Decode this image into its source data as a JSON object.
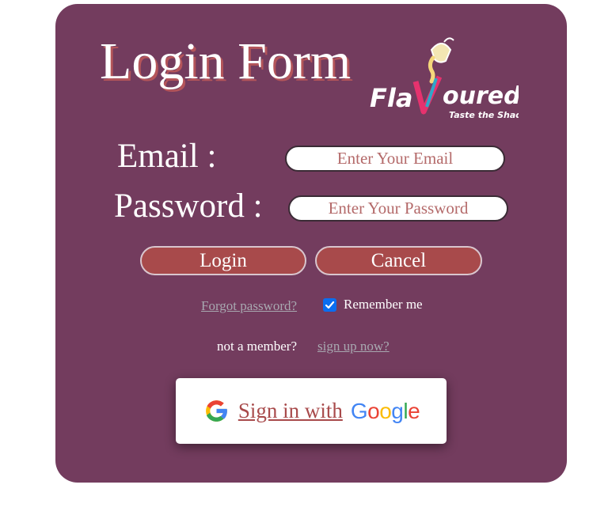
{
  "form": {
    "title": "Login Form",
    "logo": {
      "brand": "FlaVoured",
      "tagline": "Taste the Shades",
      "icon": "paint-cup-icon"
    },
    "email": {
      "label": "Email :",
      "placeholder": "Enter Your Email",
      "value": ""
    },
    "password": {
      "label": "Password :",
      "placeholder": "Enter Your Password",
      "value": ""
    },
    "buttons": {
      "login_label": "Login",
      "cancel_label": "Cancel"
    },
    "forgot_password_label": "Forgot password?",
    "remember_me": {
      "label": "Remember me",
      "checked": true
    },
    "signup_prompt": "not a member?",
    "signup_link_label": "sign up now?",
    "google": {
      "label": "Sign in with",
      "word": [
        "G",
        "o",
        "o",
        "g",
        "l",
        "e"
      ],
      "icon": "google-g-icon"
    }
  },
  "colors": {
    "card_bg": "#733c5e",
    "button_bg": "#a84a4b",
    "link": "#a8a8b0",
    "placeholder": "#b46a6a",
    "checkbox": "#0a6ef0",
    "google_blue": "#4285f4",
    "google_red": "#ea4335",
    "google_yellow": "#fbbc05",
    "google_green": "#34a853"
  }
}
